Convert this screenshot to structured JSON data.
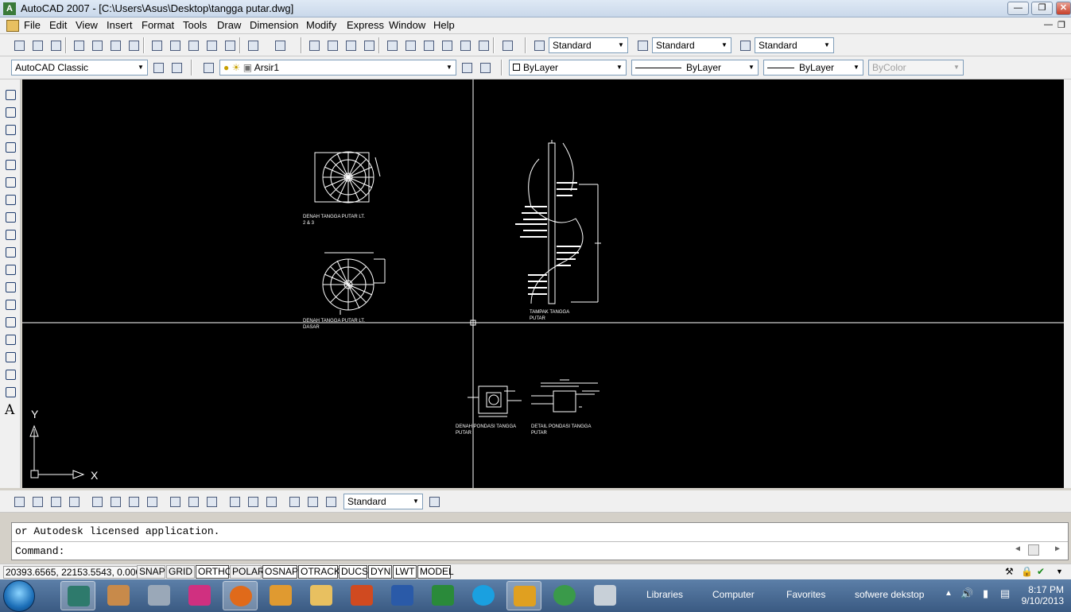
{
  "window": {
    "title": "AutoCAD 2007 - [C:\\Users\\Asus\\Desktop\\tangga putar.dwg]",
    "app_icon": "autocad-icon",
    "controls": [
      "minimize",
      "restore",
      "close"
    ]
  },
  "menu": [
    "File",
    "Edit",
    "View",
    "Insert",
    "Format",
    "Tools",
    "Draw",
    "Dimension",
    "Modify",
    "Express",
    "Window",
    "Help"
  ],
  "styles_toolbar": {
    "text_style": "Standard",
    "dim_style": "Standard",
    "table_style": "Standard"
  },
  "layers_toolbar": {
    "workspace": "AutoCAD Classic",
    "layer": "Arsir1",
    "color": "ByLayer",
    "linetype": "ByLayer",
    "lineweight": "ByLayer",
    "plotstyle": "ByColor"
  },
  "canvas": {
    "labels": {
      "plan_lt2": "DENAH TANGGA PUTAR LT.",
      "plan_lt2_sub": "2 & 3",
      "plan_lt1": "DENAH TANGGA PUTAR LT.",
      "plan_lt1_sub": "DASAR",
      "elevation": "TAMPAK TANGGA",
      "elevation_sub": "PUTAR",
      "foundation_plan": "DENAH PONDASI TANGGA",
      "foundation_plan_sub": "PUTAR",
      "foundation_detail": "DETAIL PONDASI TANGGA",
      "foundation_detail_sub": "PUTAR"
    },
    "ucs": {
      "x_label": "X",
      "y_label": "Y"
    }
  },
  "dimension_toolbar": {
    "dim_style": "Standard"
  },
  "command": {
    "history": "or Autodesk licensed application.",
    "prompt": "Command:"
  },
  "status": {
    "coordinates": "20393.6565, 22153.5543, 0.0000",
    "toggles": [
      "SNAP",
      "GRID",
      "ORTHO",
      "POLAR",
      "OSNAP",
      "OTRACK",
      "DUCS",
      "DYN",
      "LWT",
      "MODEL"
    ],
    "toggles_on": [
      "ORTHO",
      "OSNAP",
      "OTRACK",
      "DUCS",
      "DYN",
      "LWT",
      "MODEL"
    ]
  },
  "taskbar": {
    "folders": [
      "Libraries",
      "Computer",
      "Favorites",
      "sofwere dekstop"
    ],
    "time": "8:17 PM",
    "date": "9/10/2013"
  }
}
